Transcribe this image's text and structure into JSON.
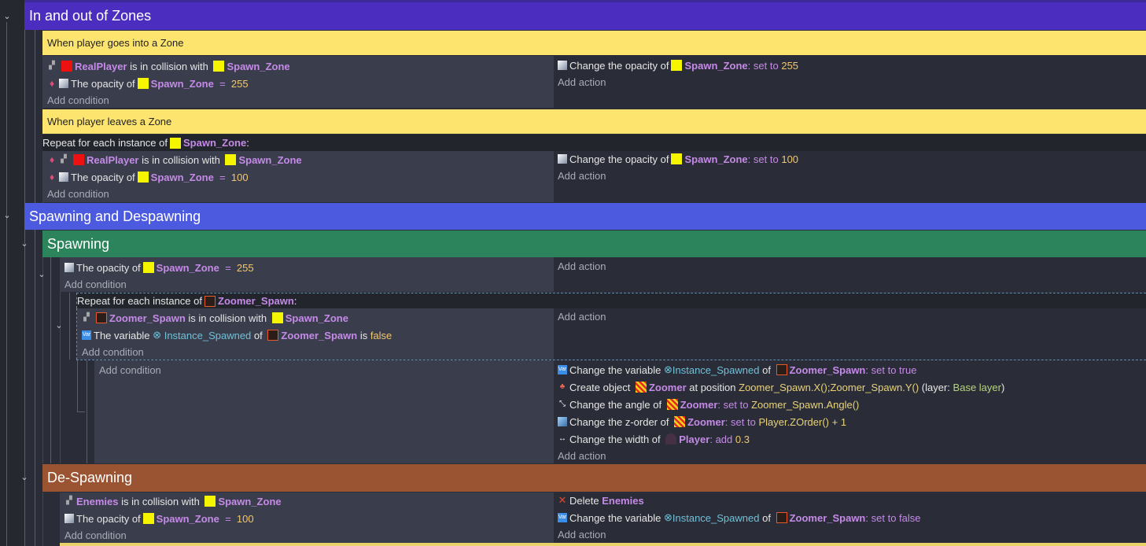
{
  "groups": {
    "zones": {
      "title": "In and out of Zones",
      "color": "#4b2dbf"
    },
    "spawning_despawning": {
      "title": "Spawning and Despawning",
      "color": "#4c5ae0"
    },
    "spawning": {
      "title": "Spawning",
      "color": "#2c845c"
    },
    "despawning": {
      "title": "De-Spawning",
      "color": "#9a5432"
    }
  },
  "comments": {
    "enter": "When player goes into a Zone",
    "leave": "When player leaves a Zone"
  },
  "common": {
    "add_condition": "Add condition",
    "add_action": "Add action",
    "repeat_prefix": "Repeat for each instance of",
    "colon": ":",
    "is_in_collision": "is in collision with",
    "the_opacity_of": "The opacity of",
    "change_opacity": "Change the opacity of",
    "eq": "=",
    "set_to": "set to",
    "colon_suffix": ":",
    "the_variable": "The variable",
    "of": "of",
    "is": "is",
    "change_variable": "Change the variable",
    "create_object": "Create object",
    "at_position": "at position",
    "layer_open": "(layer:",
    "layer_close": ")",
    "change_angle": "Change the angle of",
    "change_zorder": "Change the z-order of",
    "change_width": "Change the width of",
    "add": "add",
    "delete": "Delete"
  },
  "objects": {
    "realplayer": "RealPlayer",
    "spawn_zone": "Spawn_Zone",
    "zoomer_spawn": "Zoomer_Spawn",
    "zoomer": "Zoomer",
    "player": "Player",
    "enemies": "Enemies"
  },
  "values": {
    "v255": "255",
    "v100": "100",
    "instance_spawned": "Instance_Spawned",
    "false": "false",
    "set_to_true": "set to true",
    "set_to_false": "set to false",
    "pos_expr": "Zoomer_Spawn.X();Zoomer_Spawn.Y()",
    "base_layer": "Base layer",
    "angle_expr": "Zoomer_Spawn.Angle()",
    "zorder_expr": "Player.ZOrder() + 1",
    "width_val": "0.3"
  },
  "icons": [
    "chevron-down-icon",
    "collision-icon",
    "opacity-icon",
    "for-each-icon",
    "variable-icon",
    "create-object-icon",
    "angle-icon",
    "z-order-icon",
    "width-icon",
    "delete-icon"
  ],
  "colors": {
    "object_name": "#c58ae8",
    "number": "#f2c66d",
    "variable": "#6fc0d8",
    "comment_bg": "#fde46f"
  }
}
